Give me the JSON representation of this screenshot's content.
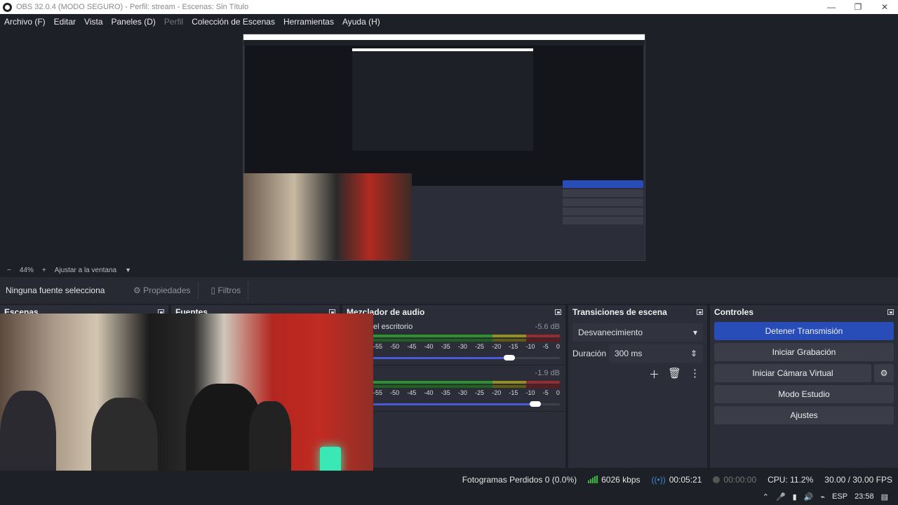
{
  "window": {
    "title": "OBS 32.0.4 (MODO SEGURO) - Perfil: stream - Escenas: Sin Título",
    "minimize": "—",
    "maximize": "❐",
    "close": "✕"
  },
  "menu": [
    "Archivo (F)",
    "Editar",
    "Vista",
    "Paneles (D)",
    "Perfil",
    "Colección de Escenas",
    "Herramientas",
    "Ayuda (H)"
  ],
  "zoom": {
    "minus": "−",
    "value": "44%",
    "plus": "+",
    "fit": "Ajustar a la ventana"
  },
  "source_bar": {
    "selected": "Ninguna fuente selecciona",
    "properties": "Propiedades",
    "filters": "Filtros"
  },
  "docks": {
    "scenes": "Escenas",
    "sources": "Fuentes",
    "mixer": "Mezclador de audio",
    "transitions": "Transiciones de escena",
    "controls": "Controles"
  },
  "mixer": {
    "channels": [
      {
        "name": "el escritorio",
        "db": "-5.6 dB",
        "level": 0.73
      },
      {
        "name": "",
        "db": "-1.9 dB",
        "level": 0.87
      }
    ],
    "scale": [
      "-55",
      "-50",
      "-45",
      "-40",
      "-35",
      "-30",
      "-25",
      "-20",
      "-15",
      "-10",
      "-5",
      "0"
    ]
  },
  "transitions": {
    "selected": "Desvanecimiento",
    "duration_label": "Duración",
    "duration": "300 ms"
  },
  "controls": {
    "stream": "Detener Transmisión",
    "record": "Iniciar Grabación",
    "virtual_cam": "Iniciar Cámara Virtual",
    "studio": "Modo Estudio",
    "settings": "Ajustes"
  },
  "status": {
    "dropped": "Fotogramas Perdidos 0 (0.0%)",
    "bitrate": "6026 kbps",
    "stream_time": "00:05:21",
    "rec_time": "00:00:00",
    "cpu": "CPU: 11.2%",
    "fps": "30.00 / 30.00 FPS"
  },
  "taskbar": {
    "lang": "ESP",
    "time": "23:58"
  },
  "colors": {
    "accent": "#284cb8",
    "panel": "#2b2e38",
    "background": "#1e2027"
  }
}
